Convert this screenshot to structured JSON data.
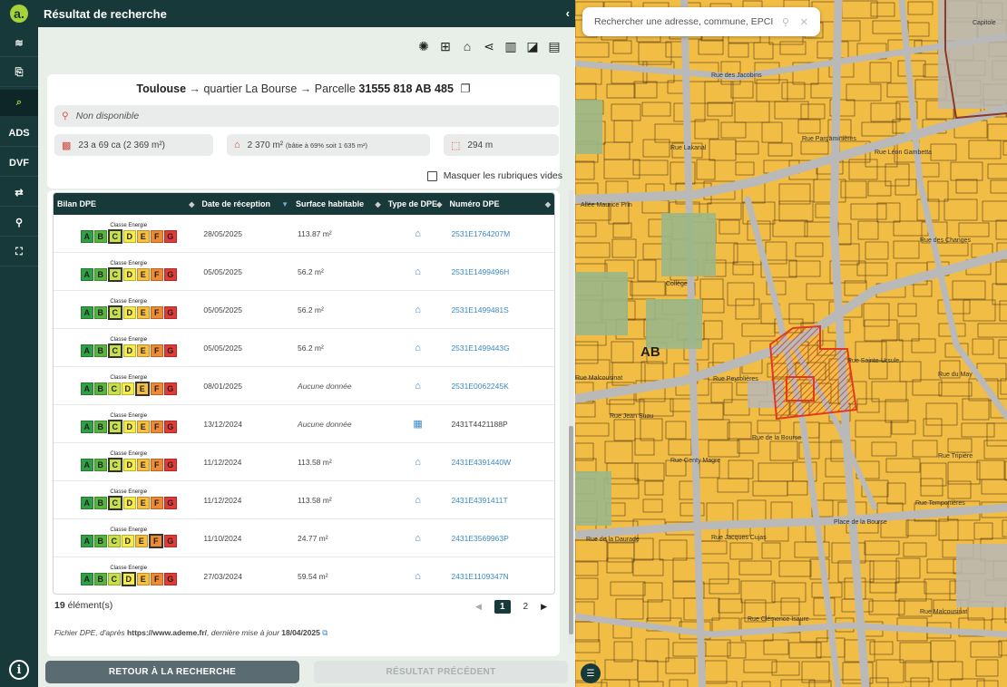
{
  "panel": {
    "title": "Résultat de recherche",
    "collapse_glyph": "‹"
  },
  "rail": {
    "items": [
      {
        "icon": "layers-icon",
        "glyph": "≋"
      },
      {
        "icon": "clipboard-icon",
        "glyph": "⎘"
      },
      {
        "icon": "parcel-search-icon",
        "glyph": "⌕"
      },
      {
        "icon": "ads-icon",
        "glyph": "ADS"
      },
      {
        "icon": "dve-icon",
        "glyph": "DVF"
      },
      {
        "icon": "exchange-icon",
        "glyph": "⇄"
      },
      {
        "icon": "location-settings-icon",
        "glyph": "⚲"
      },
      {
        "icon": "fullscreen-icon",
        "glyph": "⛶"
      }
    ],
    "info_glyph": "i"
  },
  "toolbar": {
    "items": [
      {
        "name": "color-wheel-icon",
        "glyph": "✺"
      },
      {
        "name": "add-icon",
        "glyph": "⊞"
      },
      {
        "name": "buildings-icon",
        "glyph": "⌂"
      },
      {
        "name": "share-icon",
        "glyph": "⋖"
      },
      {
        "name": "map-icon",
        "glyph": "▥"
      },
      {
        "name": "compare-map-icon",
        "glyph": "◪"
      },
      {
        "name": "pdf-icon",
        "glyph": "▤"
      }
    ]
  },
  "parcel": {
    "city": "Toulouse",
    "arrow1": " → ",
    "quarter": "quartier La Bourse",
    "arrow2": " → Parcelle ",
    "reference": "31555 818 AB 485",
    "copy_glyph": "❐",
    "address": "Non disponible",
    "area": "23 a 69 ca (2 369 m²)",
    "built_main": "2 370 m²",
    "built_detail": "(bâtie à 69% soit 1 635 m²)",
    "perimeter": "294 m"
  },
  "filter": {
    "mask_empty_label": "Masquer les rubriques vides"
  },
  "table": {
    "headers": [
      "Bilan DPE",
      "Date de réception",
      "Surface habitable",
      "Type de DPE",
      "Numéro DPE"
    ],
    "energy_label": "Classe Energie",
    "letters": [
      "A",
      "B",
      "C",
      "D",
      "E",
      "F",
      "G"
    ],
    "letter_colors": [
      "#2fa046",
      "#58b43f",
      "#c7e04a",
      "#f5ec4c",
      "#f8bf3e",
      "#ee8a35",
      "#e43a36"
    ],
    "rows": [
      {
        "cls": "C",
        "date": "28/05/2025",
        "surface": "113.87 m²",
        "type_glyph": "⌂",
        "num": "2531E1764207M",
        "nodata": false,
        "link": true
      },
      {
        "cls": "C",
        "date": "05/05/2025",
        "surface": "56.2 m²",
        "type_glyph": "⌂",
        "num": "2531E1499496H",
        "nodata": false,
        "link": true
      },
      {
        "cls": "C",
        "date": "05/05/2025",
        "surface": "56.2 m²",
        "type_glyph": "⌂",
        "num": "2531E1499481S",
        "nodata": false,
        "link": true
      },
      {
        "cls": "C",
        "date": "05/05/2025",
        "surface": "56.2 m²",
        "type_glyph": "⌂",
        "num": "2531E1499443G",
        "nodata": false,
        "link": true
      },
      {
        "cls": "E",
        "date": "08/01/2025",
        "surface": "Aucune donnée",
        "type_glyph": "⌂",
        "num": "2531E0062245K",
        "nodata": true,
        "link": true
      },
      {
        "cls": "C",
        "date": "13/12/2024",
        "surface": "Aucune donnée",
        "type_glyph": "▦",
        "num": "2431T4421188P",
        "nodata": true,
        "link": false
      },
      {
        "cls": "C",
        "date": "11/12/2024",
        "surface": "113.58 m²",
        "type_glyph": "⌂",
        "num": "2431E4391440W",
        "nodata": false,
        "link": true
      },
      {
        "cls": "C",
        "date": "11/12/2024",
        "surface": "113.58 m²",
        "type_glyph": "⌂",
        "num": "2431E4391411T",
        "nodata": false,
        "link": true
      },
      {
        "cls": "F",
        "date": "11/10/2024",
        "surface": "24.77 m²",
        "type_glyph": "⌂",
        "num": "2431E3569963P",
        "nodata": false,
        "link": true
      },
      {
        "cls": "D",
        "date": "27/03/2024",
        "surface": "59.54 m²",
        "type_glyph": "⌂",
        "num": "2431E1109347N",
        "nodata": false,
        "link": true
      }
    ]
  },
  "footer": {
    "count": "19",
    "count_suffix": " élément(s)",
    "pages": [
      "1",
      "2"
    ],
    "prev_glyph": "◀",
    "next_glyph": "▶",
    "source_a": "Fichier DPE",
    "source_b": ", d'après ",
    "source_url": "https://www.ademe.fr/",
    "source_c": ", dernière mise à jour ",
    "source_date": "18/04/2025",
    "ext_glyph": "⧉"
  },
  "buttons": {
    "back": "RETOUR À LA RECHERCHE",
    "previous": "RÉSULTAT PRÉCÉDENT"
  },
  "map": {
    "search_placeholder": "Rechercher une adresse, commune, EPCI",
    "section_label": "AB",
    "labels": [
      "Capitole",
      "Rue des Jacobins",
      "Allée Maurice Prin",
      "Collège",
      "Rue Malcousinat",
      "Rue Jean Suau",
      "Rue de la Bourse",
      "Rue Temponières",
      "Rue Jacques Cujas",
      "Rue de la Daurade",
      "Place de la Bourse",
      "Rue Clémence Isaure",
      "Rue Malcousinat",
      "Rue des Changes",
      "Rue Léon Gambetta",
      "Rue du May",
      "Rue Tripière",
      "Rue Genty Magre",
      "Rue Lakanal",
      "Rue Pargaminières",
      "Rue Sainte-Ursule",
      "Rue Peyrolières"
    ],
    "colors": {
      "parcel": "#f1bd45",
      "street": "#b3b3b3",
      "selection": "#e33a1f"
    }
  }
}
